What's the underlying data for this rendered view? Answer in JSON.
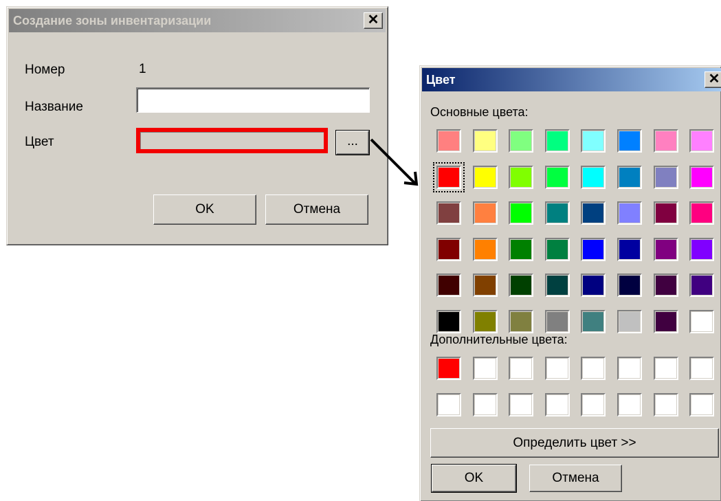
{
  "zone_dialog": {
    "title": "Создание зоны инвентаризации",
    "close_glyph": "✕",
    "number_label": "Номер",
    "number_value": "1",
    "name_label": "Название",
    "name_value": "",
    "color_label": "Цвет",
    "color_value": "#d4d0c8",
    "browse_label": "...",
    "ok_label": "OK",
    "cancel_label": "Отмена"
  },
  "color_dialog": {
    "title": "Цвет",
    "close_glyph": "✕",
    "basic_colors_label": "Основные цвета:",
    "custom_colors_label": "Дополнительные цвета:",
    "define_button_label": "Определить цвет >>",
    "ok_label": "OK",
    "cancel_label": "Отмена",
    "selected_basic_index": 8,
    "basic_colors": [
      "#ff8080",
      "#ffff80",
      "#80ff80",
      "#00ff80",
      "#80ffff",
      "#0080ff",
      "#ff80c0",
      "#ff80ff",
      "#ff0000",
      "#ffff00",
      "#80ff00",
      "#00ff40",
      "#00ffff",
      "#0080c0",
      "#8080c0",
      "#ff00ff",
      "#804040",
      "#ff8040",
      "#00ff00",
      "#008080",
      "#004080",
      "#8080ff",
      "#800040",
      "#ff0080",
      "#800000",
      "#ff8000",
      "#008000",
      "#008040",
      "#0000ff",
      "#0000a0",
      "#800080",
      "#8000ff",
      "#400000",
      "#804000",
      "#004000",
      "#004040",
      "#000080",
      "#000040",
      "#400040",
      "#400080",
      "#000000",
      "#808000",
      "#808040",
      "#808080",
      "#408080",
      "#c0c0c0",
      "#400040",
      "#ffffff"
    ],
    "custom_colors": [
      "#ff0000",
      "#ffffff",
      "#ffffff",
      "#ffffff",
      "#ffffff",
      "#ffffff",
      "#ffffff",
      "#ffffff",
      "#ffffff",
      "#ffffff",
      "#ffffff",
      "#ffffff",
      "#ffffff",
      "#ffffff",
      "#ffffff",
      "#ffffff"
    ]
  },
  "icons": {
    "arrow": "arrow-icon",
    "close": "close-icon"
  }
}
